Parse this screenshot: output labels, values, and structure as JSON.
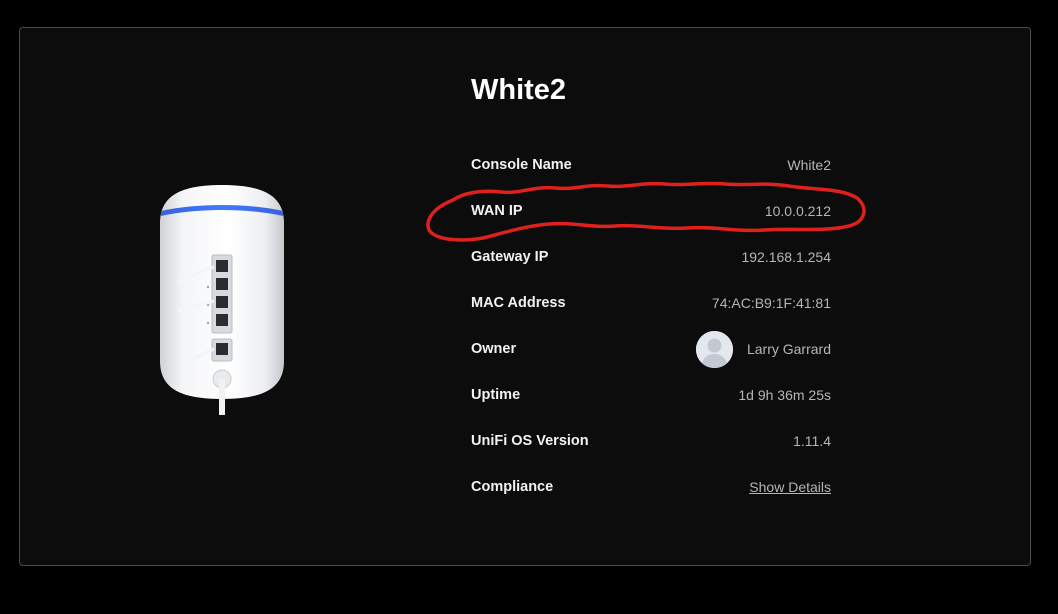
{
  "console": {
    "title": "White2"
  },
  "details": {
    "console_name": {
      "label": "Console Name",
      "value": "White2"
    },
    "wan_ip": {
      "label": "WAN IP",
      "value": "10.0.0.212"
    },
    "gateway_ip": {
      "label": "Gateway IP",
      "value": "192.168.1.254"
    },
    "mac_address": {
      "label": "MAC Address",
      "value": "74:AC:B9:1F:41:81"
    },
    "owner": {
      "label": "Owner",
      "value": "Larry Garrard",
      "avatar_icon": "user-avatar-icon"
    },
    "uptime": {
      "label": "Uptime",
      "value": "1d 9h 36m 25s"
    },
    "os_version": {
      "label": "UniFi OS Version",
      "value": "1.11.4"
    },
    "compliance": {
      "label": "Compliance",
      "link": "Show Details"
    }
  },
  "colors": {
    "background": "#000000",
    "card": "#0c0c0d",
    "card_border": "#4a4a4e",
    "label_text": "#f2f2f4",
    "value_text": "#b5b5ba",
    "device_accent": "#2f6bff",
    "annotation": "#e0201b"
  }
}
